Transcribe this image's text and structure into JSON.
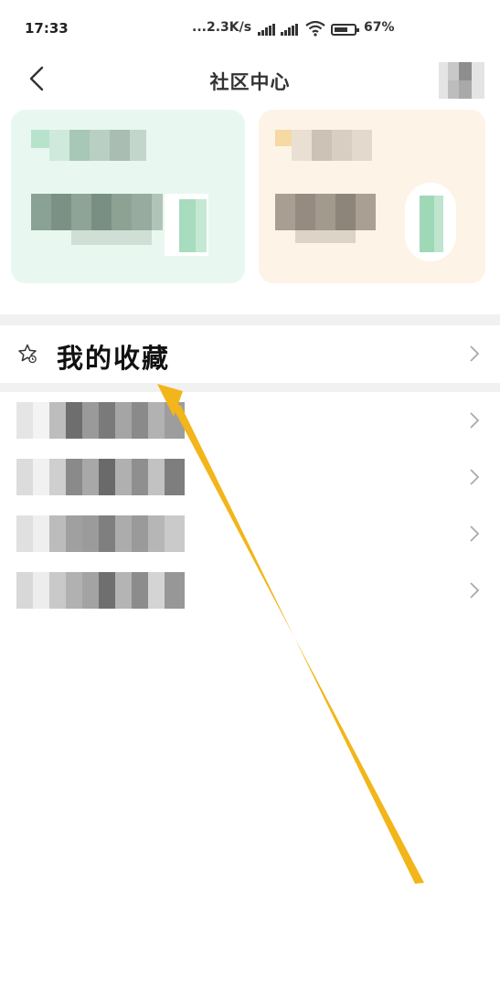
{
  "status_bar": {
    "time": "17:33",
    "network_speed": "...2.3K/s",
    "battery_percent": "67%"
  },
  "header": {
    "title": "社区中心"
  },
  "favorites": {
    "label": "我的收藏"
  },
  "colors": {
    "arrow": "#f2b51a",
    "card_green": "#e8f8f1",
    "card_orange": "#fdf4e7"
  },
  "icons": [
    "back-arrow-icon",
    "star-icon",
    "chevron-right-icon",
    "wifi-icon",
    "battery-icon",
    "signal-icon"
  ]
}
